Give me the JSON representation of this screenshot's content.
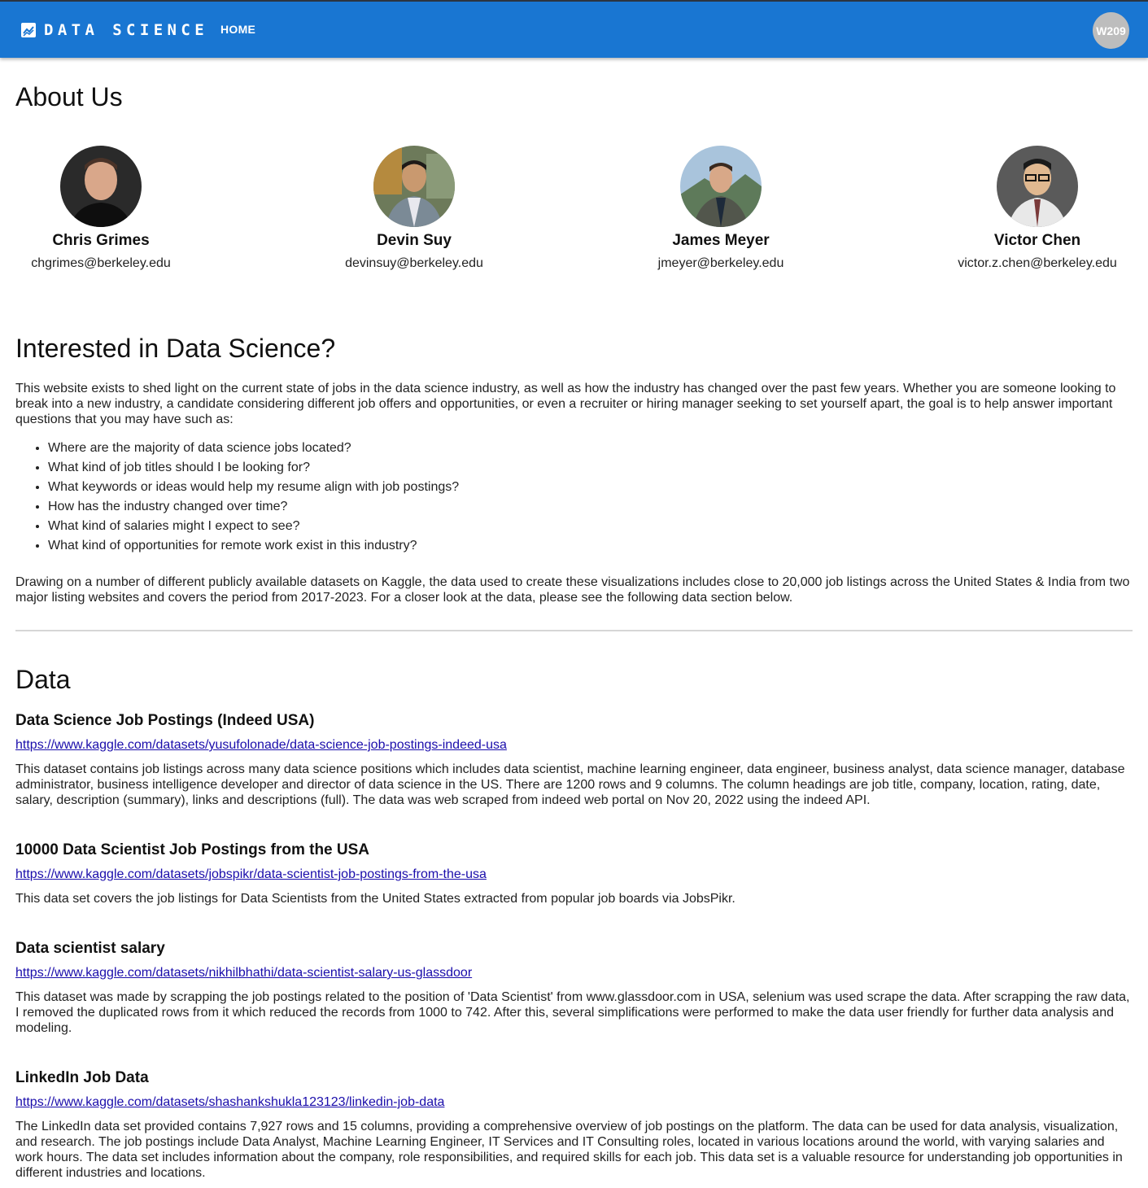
{
  "header": {
    "brand": "DATA SCIENCE",
    "nav_home": "HOME",
    "badge": "W209",
    "brand_icon": "chart-icon"
  },
  "about": {
    "title": "About Us",
    "members": [
      {
        "name": "Chris Grimes",
        "email": "chgrimes@berkeley.edu"
      },
      {
        "name": "Devin Suy",
        "email": "devinsuy@berkeley.edu"
      },
      {
        "name": "James Meyer",
        "email": "jmeyer@berkeley.edu"
      },
      {
        "name": "Victor Chen",
        "email": "victor.z.chen@berkeley.edu"
      }
    ]
  },
  "interest": {
    "title": "Interested in Data Science?",
    "intro": "This website exists to shed light on the current state of jobs in the data science industry, as well as how the industry has changed over the past few years. Whether you are someone looking to break into a new industry, a candidate considering different job offers and opportunities, or even a recruiter or hiring manager seeking to set yourself apart, the goal is to help answer important questions that you may have such as:",
    "questions": [
      "Where are the majority of data science jobs located?",
      "What kind of job titles should I be looking for?",
      "What keywords or ideas would help my resume align with job postings?",
      "How has the industry changed over time?",
      "What kind of salaries might I expect to see?",
      "What kind of opportunities for remote work exist in this industry?"
    ],
    "closing": "Drawing on a number of different publicly available datasets on Kaggle, the data used to create these visualizations includes close to 20,000 job listings across the United States & India from two major listing websites and covers the period from 2017-2023. For a closer look at the data, please see the following data section below."
  },
  "data_section": {
    "title": "Data",
    "datasets": [
      {
        "title": "Data Science Job Postings (Indeed USA)",
        "link": "https://www.kaggle.com/datasets/yusufolonade/data-science-job-postings-indeed-usa",
        "description": "This dataset contains job listings across many data science positions which includes data scientist, machine learning engineer, data engineer, business analyst, data science manager, database administrator, business intelligence developer and director of data science in the US. There are 1200 rows and 9 columns. The column headings are job title, company, location, rating, date, salary, description (summary), links and descriptions (full). The data was web scraped from indeed web portal on Nov 20, 2022 using the indeed API."
      },
      {
        "title": "10000 Data Scientist Job Postings from the USA",
        "link": "https://www.kaggle.com/datasets/jobspikr/data-scientist-job-postings-from-the-usa",
        "description": "This data set covers the job listings for Data Scientists from the United States extracted from popular job boards via JobsPikr."
      },
      {
        "title": "Data scientist salary",
        "link": "https://www.kaggle.com/datasets/nikhilbhathi/data-scientist-salary-us-glassdoor",
        "description": "This dataset was made by scrapping the job postings related to the position of 'Data Scientist' from www.glassdoor.com in USA, selenium was used scrape the data. After scrapping the raw data, I removed the duplicated rows from it which reduced the records from 1000 to 742. After this, several simplifications were performed to make the data user friendly for further data analysis and modeling."
      },
      {
        "title": "LinkedIn Job Data",
        "link": "https://www.kaggle.com/datasets/shashankshukla123123/linkedin-job-data",
        "description": "The LinkedIn data set provided contains 7,927 rows and 15 columns, providing a comprehensive overview of job postings on the platform. The data can be used for data analysis, visualization, and research. The job postings include Data Analyst, Machine Learning Engineer, IT Services and IT Consulting roles, located in various locations around the world, with varying salaries and work hours. The data set includes information about the company, role responsibilities, and required skills for each job. This data set is a valuable resource for understanding job opportunities in different industries and locations."
      }
    ]
  },
  "colors": {
    "appbar": "#1976d2",
    "link": "#1a0dab",
    "badge": "#bdbdbd"
  }
}
